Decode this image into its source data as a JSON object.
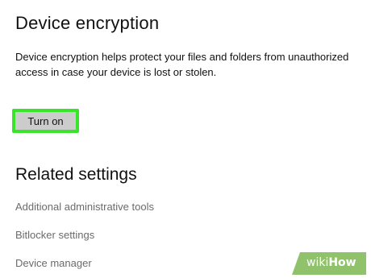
{
  "device_encryption": {
    "title": "Device encryption",
    "description": "Device encryption helps protect your files and folders from unauthorized access in case your device is lost or stolen.",
    "turn_on_label": "Turn on"
  },
  "related_settings": {
    "heading": "Related settings",
    "links": [
      "Additional administrative tools",
      "Bitlocker settings",
      "Device manager"
    ]
  },
  "watermark": {
    "prefix": "wiki",
    "suffix": "How"
  },
  "colors": {
    "highlight": "#39e52b",
    "button_bg": "#cccccc",
    "link_text": "#6b6b6b",
    "watermark_green": "#8fc26a"
  }
}
